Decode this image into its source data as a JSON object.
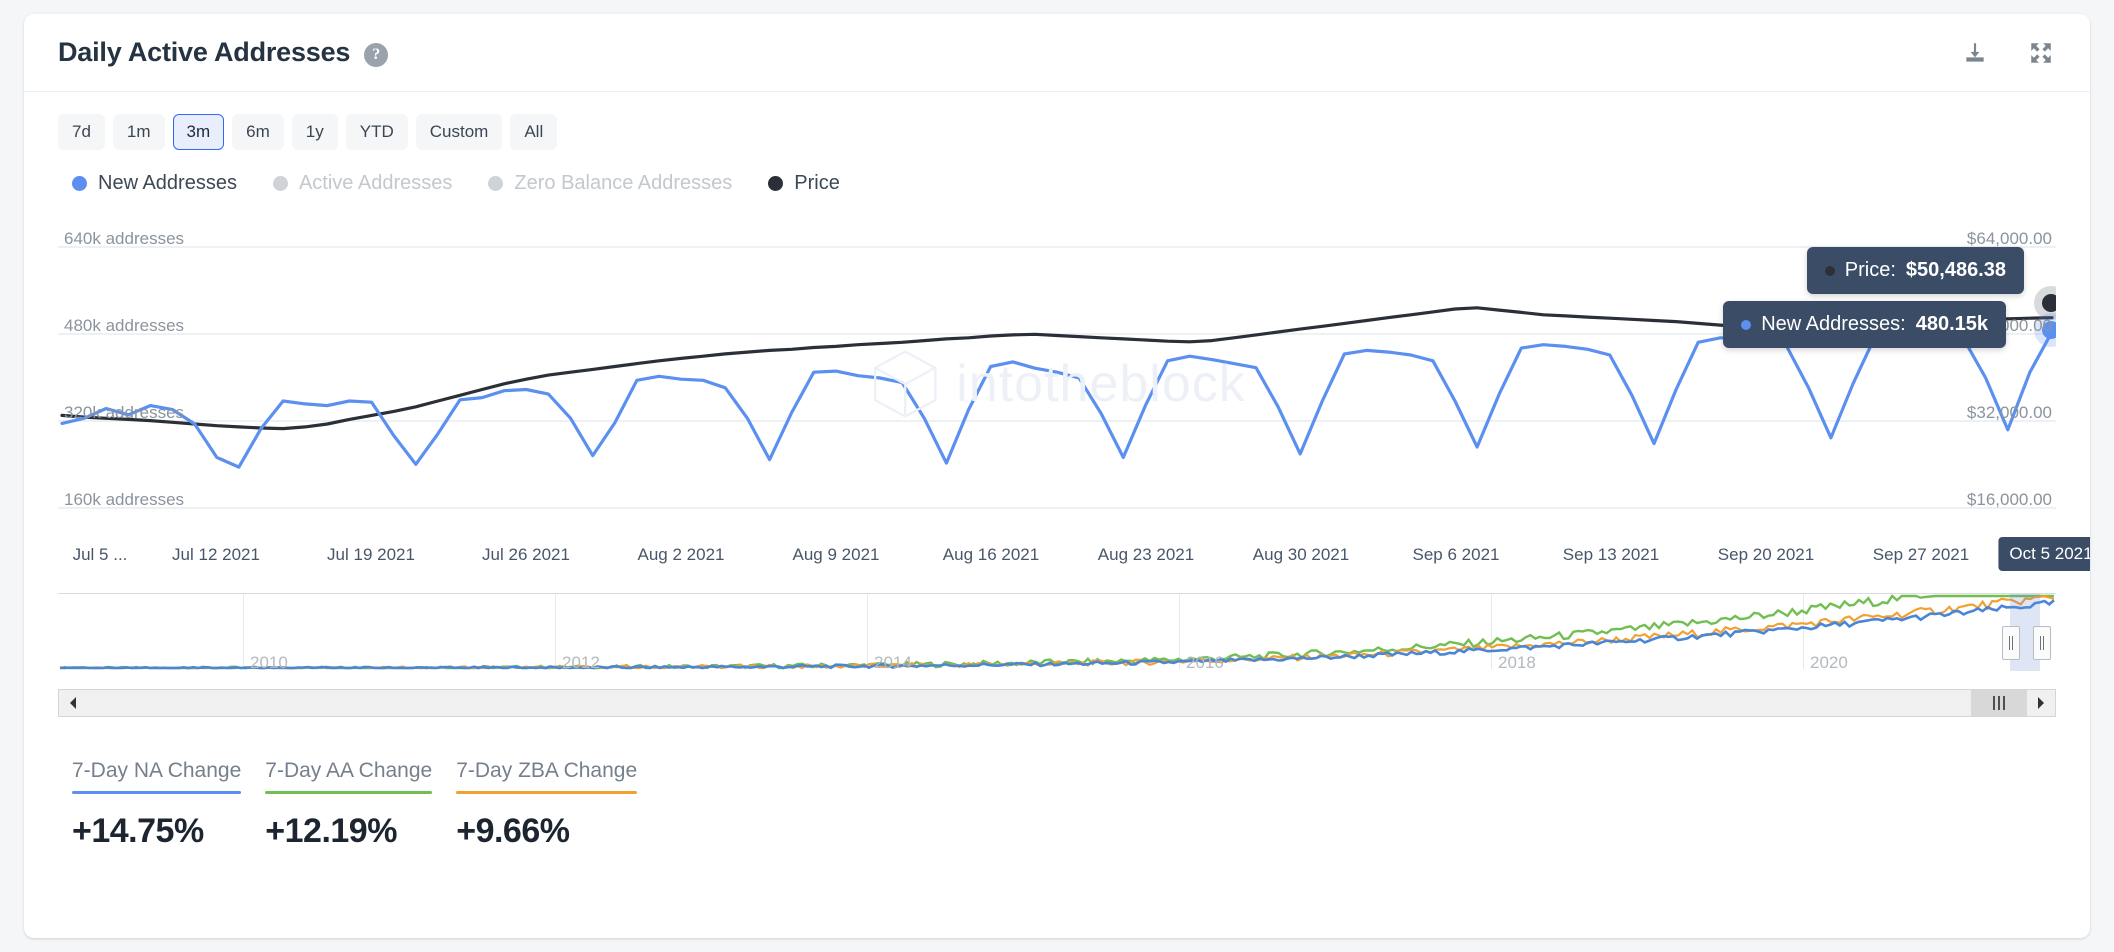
{
  "header": {
    "title": "Daily Active Addresses",
    "help_icon": "question-mark-icon",
    "download_icon": "download-icon",
    "fullscreen_icon": "fullscreen-icon"
  },
  "range_selector": {
    "options": [
      "7d",
      "1m",
      "3m",
      "6m",
      "1y",
      "YTD",
      "Custom",
      "All"
    ],
    "selected": "3m"
  },
  "legend": [
    {
      "label": "New Addresses",
      "color": "#5b8ff0",
      "active": true
    },
    {
      "label": "Active Addresses",
      "color": "#cfd3d7",
      "active": false
    },
    {
      "label": "Zero Balance Addresses",
      "color": "#cfd3d7",
      "active": false
    },
    {
      "label": "Price",
      "color": "#2b3038",
      "active": true
    }
  ],
  "watermark": "intotheblock",
  "tooltips": {
    "price": {
      "label": "Price:",
      "value": "$50,486.38",
      "dot_color": "#2b3038"
    },
    "new_addresses": {
      "label": "New Addresses:",
      "value": "480.15k",
      "dot_color": "#5b8ff0"
    }
  },
  "navigator": {
    "years": [
      "2010",
      "2012",
      "2014",
      "2016",
      "2018",
      "2020"
    ],
    "series_colors": {
      "active_addresses": "#71bf52",
      "zero_balance": "#f0a132",
      "new_addresses": "#4a86d8"
    }
  },
  "scrollbar": {
    "left_arrow": "scroll-left-icon",
    "right_arrow": "scroll-right-icon",
    "grip": "scrollbar-grip-icon"
  },
  "stats": [
    {
      "label": "7-Day NA Change",
      "value": "+14.75%",
      "color": "#5b8ff0"
    },
    {
      "label": "7-Day AA Change",
      "value": "+12.19%",
      "color": "#71bf52"
    },
    {
      "label": "7-Day ZBA Change",
      "value": "+9.66%",
      "color": "#f0a132"
    }
  ],
  "chart_data": {
    "type": "line",
    "title": "Daily Active Addresses",
    "xlabel": "",
    "ylabel": "addresses",
    "y2label": "Price",
    "grid": true,
    "legend_position": "top",
    "y_ticks": [
      "640k addresses",
      "480k addresses",
      "320k addresses",
      "160k addresses"
    ],
    "y_tick_values": [
      640000,
      480000,
      320000,
      160000
    ],
    "ylim": [
      120000,
      680000
    ],
    "y2_ticks": [
      "$64,000.00",
      "$48,000.00",
      "$32,000.00",
      "$16,000.00"
    ],
    "y2_tick_values": [
      64000,
      48000,
      32000,
      16000
    ],
    "y2lim": [
      12000,
      68000
    ],
    "x_ticks": [
      "Jul 5 ...",
      "Jul 12 2021",
      "Jul 19 2021",
      "Jul 26 2021",
      "Aug 2 2021",
      "Aug 9 2021",
      "Aug 16 2021",
      "Aug 23 2021",
      "Aug 30 2021",
      "Sep 6 2021",
      "Sep 13 2021",
      "Sep 20 2021",
      "Sep 27 2021",
      "Oct 5 2021"
    ],
    "x_tick_highlighted": "Oct 5 2021",
    "series": [
      {
        "name": "New Addresses",
        "color": "#5b8ff0",
        "axis": "left",
        "unit": "addresses",
        "values": [
          321000,
          330000,
          347000,
          336000,
          352000,
          345000,
          320000,
          262000,
          245000,
          312000,
          360000,
          355000,
          352000,
          360000,
          358000,
          300000,
          250000,
          303000,
          362000,
          366000,
          378000,
          380000,
          372000,
          330000,
          265000,
          322000,
          396000,
          403000,
          398000,
          396000,
          383000,
          330000,
          258000,
          340000,
          410000,
          412000,
          404000,
          400000,
          392000,
          330000,
          252000,
          345000,
          420000,
          428000,
          417000,
          410000,
          400000,
          338000,
          262000,
          352000,
          430000,
          438000,
          432000,
          425000,
          418000,
          350000,
          268000,
          360000,
          442000,
          448000,
          445000,
          440000,
          430000,
          360000,
          280000,
          372000,
          452000,
          458000,
          455000,
          450000,
          440000,
          370000,
          286000,
          380000,
          462000,
          470000,
          468000,
          462000,
          455000,
          382000,
          296000,
          390000,
          472000,
          478000,
          476000,
          472000,
          468000,
          400000,
          310000,
          410000,
          480150
        ]
      },
      {
        "name": "Price",
        "color": "#2b3038",
        "axis": "right",
        "unit": "USD",
        "values": [
          33500,
          33200,
          33000,
          32800,
          32600,
          32300,
          32000,
          31700,
          31500,
          31300,
          31200,
          31500,
          32000,
          32800,
          33500,
          34200,
          35000,
          36000,
          37000,
          38000,
          39000,
          39800,
          40500,
          41000,
          41500,
          42000,
          42500,
          43000,
          43400,
          43800,
          44200,
          44500,
          44800,
          45000,
          45300,
          45500,
          45800,
          46000,
          46200,
          46500,
          46800,
          47000,
          47300,
          47500,
          47600,
          47400,
          47200,
          47000,
          46800,
          46600,
          46400,
          46300,
          46500,
          47000,
          47500,
          48000,
          48500,
          49000,
          49500,
          50000,
          50500,
          51000,
          51500,
          52000,
          52200,
          51800,
          51400,
          51000,
          50800,
          50600,
          50400,
          50200,
          50000,
          49800,
          49500,
          49200,
          48900,
          48600,
          48400,
          48200,
          48000,
          48200,
          48600,
          49000,
          49400,
          49800,
          50200,
          50400,
          50300,
          50400,
          50486.38
        ]
      }
    ],
    "navigator_series": [
      {
        "name": "Active Addresses",
        "color": "#71bf52"
      },
      {
        "name": "Zero Balance Addresses",
        "color": "#f0a132"
      },
      {
        "name": "New Addresses",
        "color": "#4a86d8"
      }
    ],
    "highlighted_point": {
      "x": "Oct 5 2021",
      "price": 50486.38,
      "new_addresses": 480150
    }
  }
}
